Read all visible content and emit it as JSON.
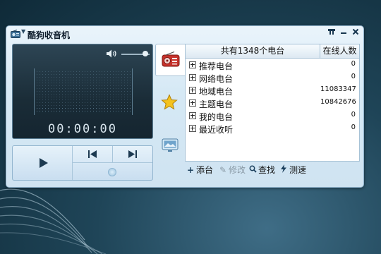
{
  "window": {
    "title": "酷狗收音机",
    "buttons": [
      "mini-mode",
      "minimize",
      "close"
    ]
  },
  "player": {
    "time": "00:00:00",
    "volume_level": 0.9
  },
  "side_tabs": [
    "radio-icon",
    "star-icon",
    "screen-icon"
  ],
  "list": {
    "header_name": "共有1348个电台",
    "header_count": "在线人数",
    "rows": [
      {
        "name": "推荐电台",
        "count": "0"
      },
      {
        "name": "网络电台",
        "count": "0"
      },
      {
        "name": "地域电台",
        "count": "11083347"
      },
      {
        "name": "主题电台",
        "count": "10842676"
      },
      {
        "name": "我的电台",
        "count": "0"
      },
      {
        "name": "最近收听",
        "count": "0"
      }
    ]
  },
  "toolbar": {
    "add": "添台",
    "edit": "修改",
    "search": "查找",
    "speedtest": "测速"
  },
  "colors": {
    "accent": "#1f4558",
    "panel": "#d6e9f5",
    "display": "#1a2c37"
  }
}
